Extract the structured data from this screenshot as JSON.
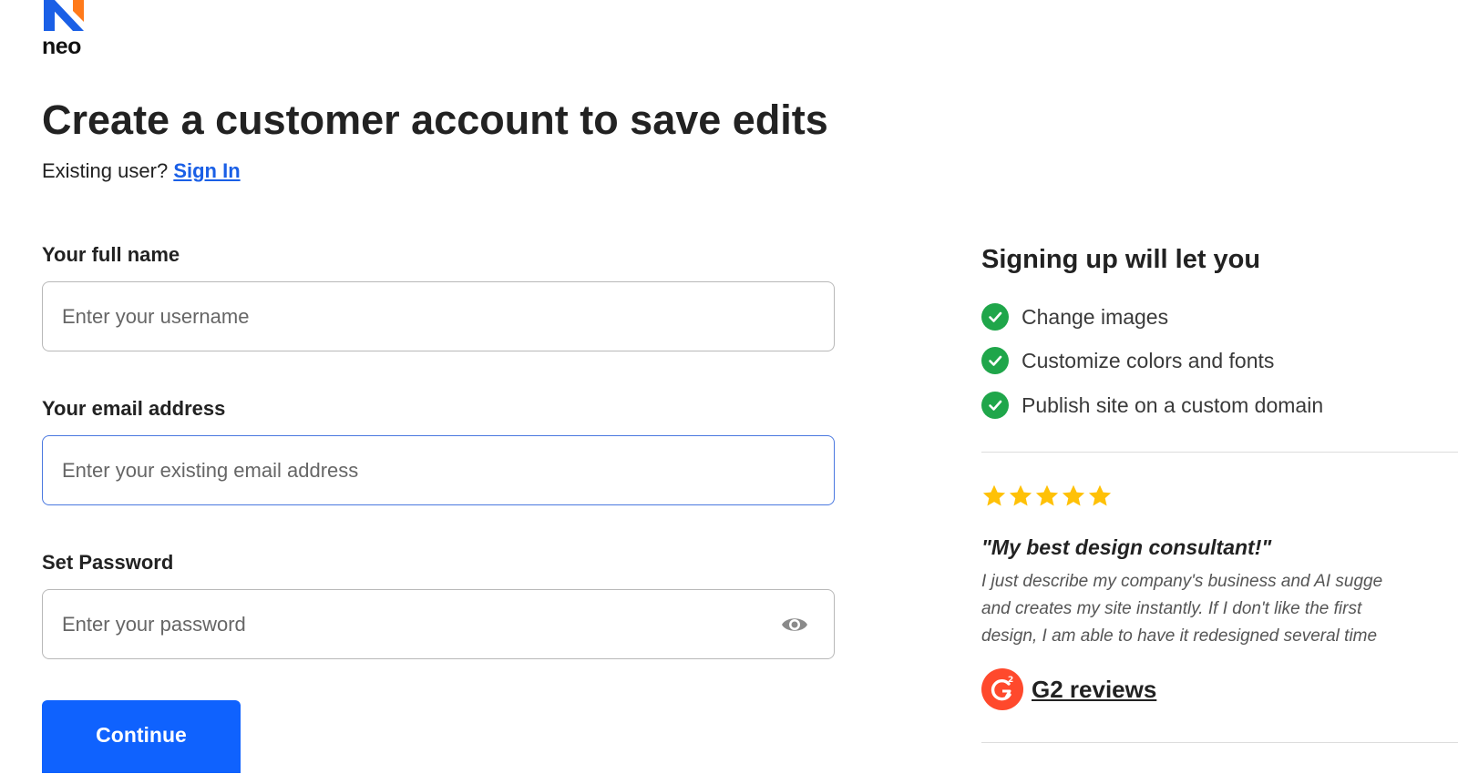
{
  "brand": {
    "name": "neo",
    "colors": {
      "primary": "#0f62fe",
      "logo_blue": "#1a5fe6",
      "logo_orange": "#ff7a1a",
      "success": "#1fa64a",
      "star": "#ffc107",
      "g2_red": "#ff492c"
    }
  },
  "header": {
    "title": "Create a customer account to save edits",
    "existing_user_text": "Existing user?",
    "sign_in_label": "Sign In"
  },
  "form": {
    "full_name": {
      "label": "Your full name",
      "placeholder": "Enter your username",
      "value": ""
    },
    "email": {
      "label": "Your email address",
      "placeholder": "Enter your existing email address",
      "value": ""
    },
    "password": {
      "label": "Set Password",
      "placeholder": "Enter your password",
      "value": "",
      "toggle_icon": "eye-icon"
    },
    "continue_label": "Continue"
  },
  "sidebar": {
    "title": "Signing up will let you",
    "benefits": [
      {
        "label": "Change images",
        "icon": "check-circle-icon"
      },
      {
        "label": "Customize colors and fonts",
        "icon": "check-circle-icon"
      },
      {
        "label": "Publish site on a custom domain",
        "icon": "check-circle-icon"
      }
    ],
    "review": {
      "rating": 5,
      "title": "\"My best design consultant!\"",
      "body_lines": [
        "I just describe my company's business and AI sugge",
        "and creates my site instantly. If I don't like the first",
        "design, I am able to have it redesigned several time"
      ],
      "source_label": "G2 reviews",
      "source_icon": "g2-logo-icon"
    }
  }
}
